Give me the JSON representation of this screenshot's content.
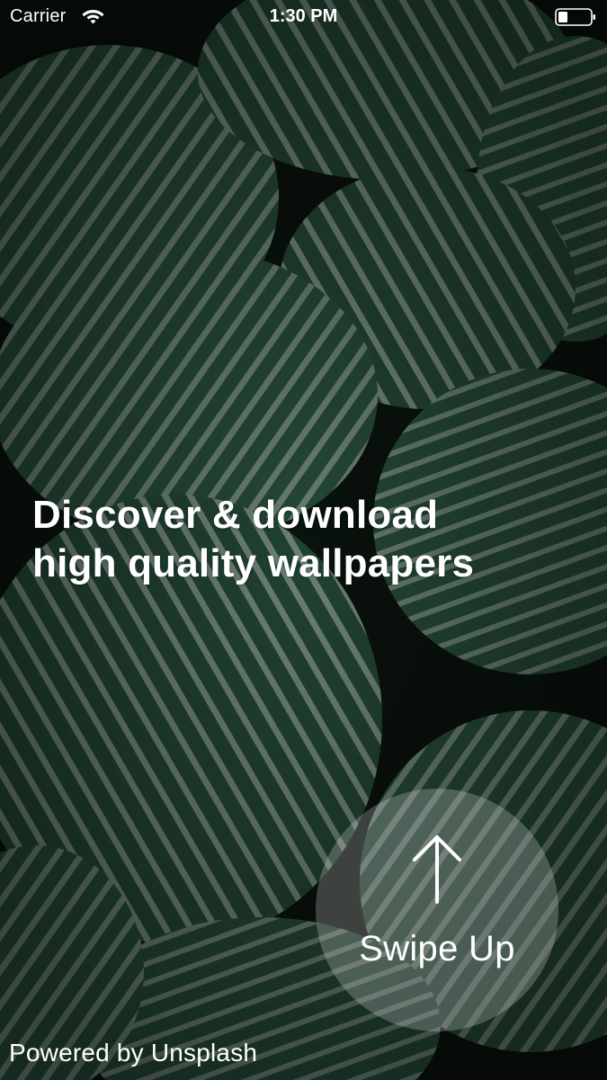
{
  "status_bar": {
    "carrier": "Carrier",
    "time": "1:30 PM",
    "wifi_icon": "wifi-icon",
    "battery_icon": "battery-icon"
  },
  "onboarding": {
    "headline_line1": "Discover & download",
    "headline_line2": "high quality wallpapers",
    "swipe_label": "Swipe Up",
    "swipe_icon": "arrow-up-icon"
  },
  "footer": {
    "credit": "Powered by Unsplash"
  },
  "colors": {
    "text": "#ffffff",
    "background_dark": "#0e1a12",
    "leaf_green": "#2f5b44",
    "leaf_stripe": "#9fb5a9"
  }
}
